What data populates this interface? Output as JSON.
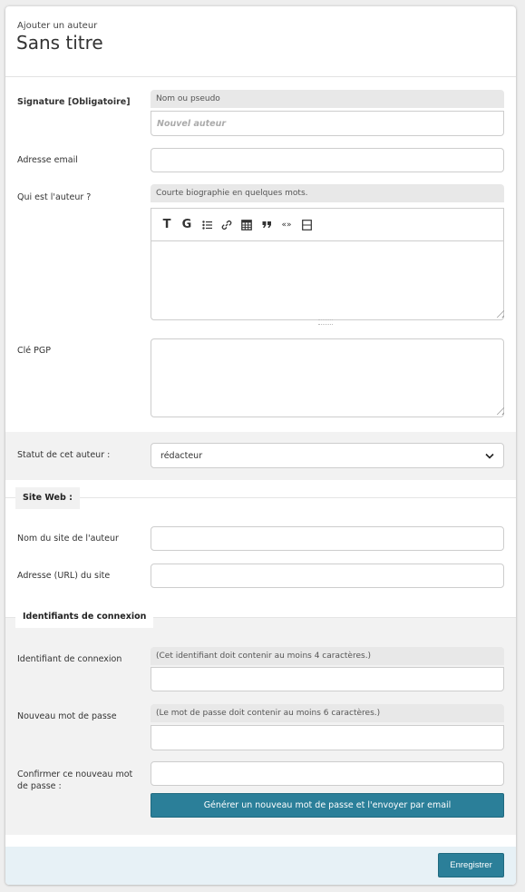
{
  "header": {
    "subtitle": "Ajouter un auteur",
    "title": "Sans titre"
  },
  "fields": {
    "signature": {
      "label": "Signature [Obligatoire]",
      "explanation": "Nom ou pseudo",
      "placeholder": "Nouvel auteur",
      "value": ""
    },
    "email": {
      "label": "Adresse email",
      "value": ""
    },
    "bio": {
      "label": "Qui est l'auteur ?",
      "explanation": "Courte biographie en quelques mots.",
      "value": ""
    },
    "pgp": {
      "label": "Clé PGP",
      "value": ""
    },
    "status": {
      "label": "Statut de cet auteur :",
      "selected": "rédacteur"
    }
  },
  "editor_toolbar": {
    "icons": [
      "bold-icon",
      "heading-icon",
      "list-icon",
      "link-icon",
      "table-icon",
      "quote-icon",
      "guillemets-icon",
      "preview-icon"
    ],
    "bold_glyph": "T",
    "heading_glyph": "G",
    "guillemets_glyph": "«»"
  },
  "website": {
    "legend": "Site Web :",
    "site_name": {
      "label": "Nom du site de l'auteur",
      "value": ""
    },
    "site_url": {
      "label": "Adresse (URL) du site",
      "value": ""
    }
  },
  "login": {
    "legend": "Identifiants de connexion",
    "login_id": {
      "label": "Identifiant de connexion",
      "explanation": "(Cet identifiant doit contenir au moins 4 caractères.)",
      "value": ""
    },
    "new_password": {
      "label": "Nouveau mot de passe",
      "explanation": "(Le mot de passe doit contenir au moins 6 caractères.)",
      "value": ""
    },
    "confirm_password": {
      "label": "Confirmer ce nouveau mot de passe :",
      "value": ""
    },
    "generate_button": "Générer un nouveau mot de passe et l'envoyer par email"
  },
  "footer": {
    "save_button": "Enregistrer"
  },
  "colors": {
    "primary_button": "#2b7f99",
    "footer_bg": "#e7f1f6",
    "shade_bg": "#f2f2f2"
  }
}
